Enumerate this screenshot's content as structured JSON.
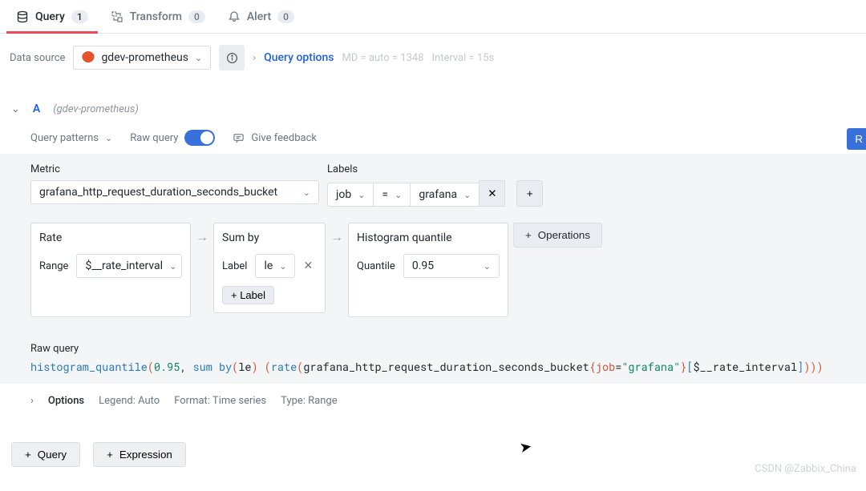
{
  "tabs": {
    "query": {
      "label": "Query",
      "count": "1"
    },
    "transform": {
      "label": "Transform",
      "count": "0"
    },
    "alert": {
      "label": "Alert",
      "count": "0"
    }
  },
  "dsRow": {
    "label": "Data source",
    "selected": "gdev-prometheus",
    "queryOptions": "Query options",
    "hintMD": "MD = auto = 1348",
    "hintInterval": "Interval = 15s"
  },
  "query": {
    "letter": "A",
    "ds": "(gdev-prometheus)",
    "toolbar": {
      "patterns": "Query patterns",
      "raw": "Raw query",
      "feedback": "Give feedback",
      "run": "R"
    },
    "metric": {
      "label": "Metric",
      "value": "grafana_http_request_duration_seconds_bucket"
    },
    "labels": {
      "label": "Labels",
      "key": "job",
      "op": "=",
      "val": "grafana"
    },
    "ops": {
      "rate": {
        "title": "Rate",
        "param": "Range",
        "value": "$__rate_interval"
      },
      "sumby": {
        "title": "Sum by",
        "param": "Label",
        "value": "le",
        "addLabel": "+ Label"
      },
      "hist": {
        "title": "Histogram quantile",
        "param": "Quantile",
        "value": "0.95"
      },
      "add": "Operations"
    },
    "rawQuery": {
      "label": "Raw query",
      "tokens": {
        "fn": "histogram_quantile",
        "num": "0.95",
        "sum": "sum",
        "by": "by",
        "le": "le",
        "rate": "rate",
        "metric": "grafana_http_request_duration_seconds_bucket",
        "key": "job",
        "eq": "=",
        "val": "\"grafana\"",
        "interval": "$__rate_interval"
      }
    },
    "options": {
      "label": "Options",
      "legend": "Legend: Auto",
      "format": "Format: Time series",
      "type": "Type: Range"
    }
  },
  "bottom": {
    "query": "Query",
    "expression": "Expression"
  },
  "watermark": "CSDN @Zabbix_China"
}
